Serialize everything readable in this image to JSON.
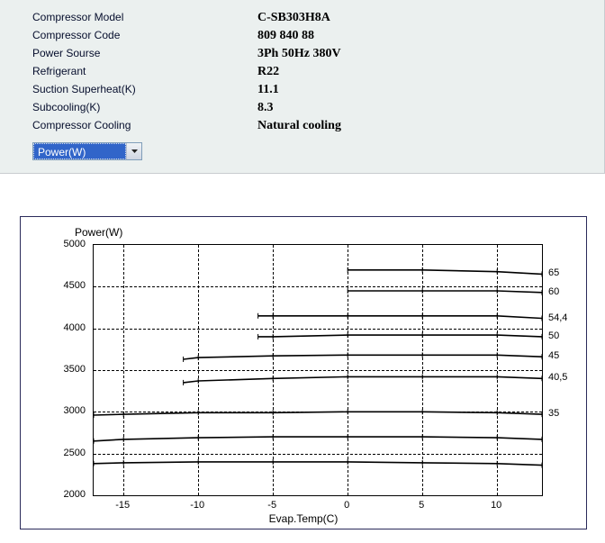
{
  "specs": {
    "model_label": "Compressor Model",
    "model_value": "C-SB303H8A",
    "code_label": "Compressor Code",
    "code_value": "809 840 88",
    "power_source_label": "Power Sourse",
    "power_source_value": "3Ph  50Hz  380V",
    "refrigerant_label": "Refrigerant",
    "refrigerant_value": "R22",
    "superheat_label": "Suction Superheat(K)",
    "superheat_value": "11.1",
    "subcooling_label": "Subcooling(K)",
    "subcooling_value": "8.3",
    "cooling_label": "Compressor Cooling",
    "cooling_value": "Natural cooling"
  },
  "dropdown": {
    "selected": "Power(W)"
  },
  "chart": {
    "title": "Power(W)",
    "xlabel": "Evap.Temp(C)",
    "y_ticks": [
      "5000",
      "4500",
      "4000",
      "3500",
      "3000",
      "2500",
      "2000"
    ],
    "x_ticks": [
      "-15",
      "-10",
      "-5",
      "0",
      "5",
      "10"
    ],
    "series_labels": [
      "65",
      "60",
      "54,4",
      "50",
      "45",
      "40,5",
      "35"
    ]
  },
  "chart_data": {
    "type": "line",
    "title": "Power(W)",
    "xlabel": "Evap.Temp(C)",
    "ylabel": "Power(W)",
    "xlim": [
      -17,
      13
    ],
    "ylim": [
      2000,
      5000
    ],
    "x": [
      -17,
      -15,
      -10,
      -5,
      0,
      5,
      10,
      13
    ],
    "grid": true,
    "legend_position": "right-outside",
    "series": [
      {
        "name": "65",
        "x": [
          0,
          5,
          10,
          13
        ],
        "values": [
          4700,
          4700,
          4680,
          4650
        ]
      },
      {
        "name": "60",
        "x": [
          0,
          5,
          10,
          13
        ],
        "values": [
          4450,
          4450,
          4450,
          4430
        ]
      },
      {
        "name": "54,4",
        "x": [
          -6,
          -5,
          0,
          5,
          10,
          13
        ],
        "values": [
          4150,
          4150,
          4150,
          4150,
          4150,
          4120
        ]
      },
      {
        "name": "50",
        "x": [
          -6,
          -5,
          0,
          5,
          10,
          13
        ],
        "values": [
          3900,
          3900,
          3920,
          3920,
          3920,
          3900
        ]
      },
      {
        "name": "45",
        "x": [
          -11,
          -10,
          -5,
          0,
          5,
          10,
          13
        ],
        "values": [
          3630,
          3650,
          3670,
          3680,
          3680,
          3680,
          3660
        ]
      },
      {
        "name": "40,5",
        "x": [
          -11,
          -10,
          -5,
          0,
          5,
          10,
          13
        ],
        "values": [
          3350,
          3370,
          3400,
          3420,
          3420,
          3420,
          3400
        ]
      },
      {
        "name": "35",
        "x": [
          -17,
          -15,
          -10,
          -5,
          0,
          5,
          10,
          13
        ],
        "values": [
          2960,
          2970,
          2990,
          2990,
          3000,
          3000,
          2990,
          2970
        ]
      }
    ],
    "extra_lines_note": "Two additional lower curves visible without right-edge labels",
    "extra_series": [
      {
        "name": "(unlabeled-1)",
        "x": [
          -17,
          -15,
          -10,
          -5,
          0,
          5,
          10,
          13
        ],
        "values": [
          2650,
          2670,
          2690,
          2700,
          2700,
          2700,
          2690,
          2670
        ]
      },
      {
        "name": "(unlabeled-2)",
        "x": [
          -17,
          -15,
          -10,
          -5,
          0,
          5,
          10,
          13
        ],
        "values": [
          2380,
          2390,
          2400,
          2400,
          2400,
          2390,
          2380,
          2360
        ]
      }
    ]
  }
}
